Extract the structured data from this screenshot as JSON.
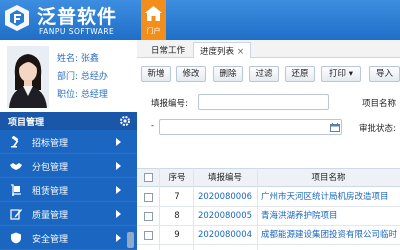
{
  "header": {
    "brand_cn": "泛普软件",
    "brand_en": "FANPU SOFTWARE",
    "home_label": "门户",
    "colors": {
      "bar": "#2a7bd3",
      "home_tile": "#f18e1c"
    }
  },
  "profile": {
    "name_label": "姓名: 张鑫",
    "dept_label": "部门: 总经办",
    "position_label": "职位: 总经理"
  },
  "sidebar": {
    "section_title": "项目管理",
    "items": [
      {
        "label": "招标管理",
        "icon": "gavel-icon"
      },
      {
        "label": "分包管理",
        "icon": "handshake-icon"
      },
      {
        "label": "租赁管理",
        "icon": "dolly-icon"
      },
      {
        "label": "质量管理",
        "icon": "edit-icon"
      },
      {
        "label": "安全管理",
        "icon": "shield-icon"
      }
    ]
  },
  "tabs": [
    {
      "label": "日常工作",
      "active": false
    },
    {
      "label": "进度列表",
      "active": true,
      "close": "×"
    }
  ],
  "toolbar": {
    "buttons": [
      "新增",
      "修改",
      "删除",
      "过滤",
      "还原",
      "打印 ▾",
      "导入"
    ]
  },
  "form": {
    "report_no_label": "填报编号:",
    "report_no_value": "",
    "project_name_label": "项目名称",
    "date_value": "",
    "audit_status_label": "审批状态:",
    "dash": "-"
  },
  "table": {
    "headers": [
      "序号",
      "填报编号",
      "项目名称"
    ],
    "rows": [
      {
        "seq": "7",
        "code": "2020080006",
        "name": "广州市天河区统计局机房改造项目"
      },
      {
        "seq": "8",
        "code": "2020080005",
        "name": "青海洪湖养护院项目"
      },
      {
        "seq": "9",
        "code": "2020080004",
        "name": "成都能源建设集团投资有限公司临时"
      }
    ]
  }
}
